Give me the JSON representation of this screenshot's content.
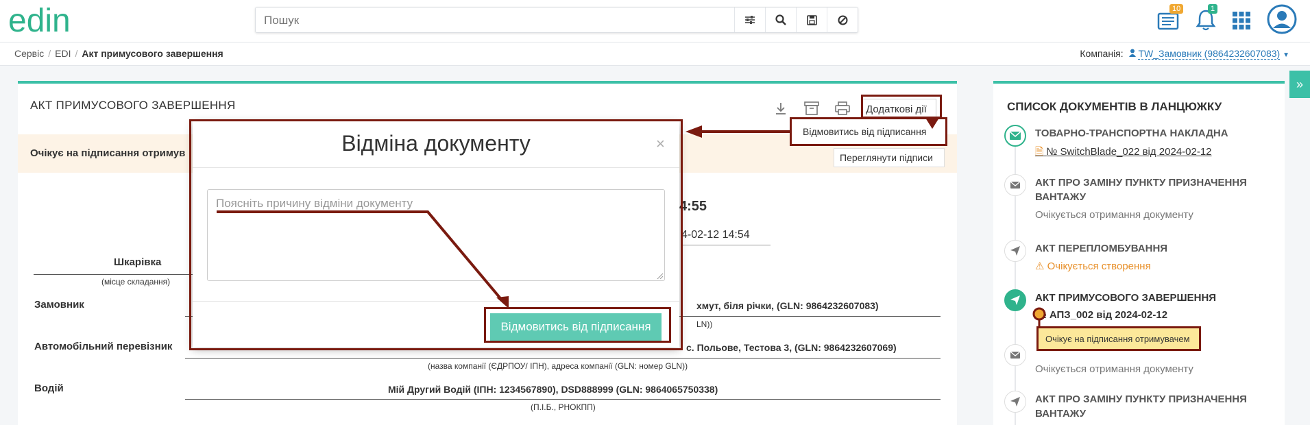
{
  "header": {
    "logo_text": "edin",
    "search_placeholder": "Пошук",
    "news_badge": "10",
    "notif_badge": "1"
  },
  "breadcrumb": {
    "items": [
      "Сервіс",
      "EDI"
    ],
    "current": "Акт примусового завершення",
    "company_label": "Компанія:",
    "company_value": "TW_Замовник (9864232607083)"
  },
  "main": {
    "title": "АКТ ПРИМУСОВОГО ЗАВЕРШЕННЯ",
    "more_actions": "Додаткові дії",
    "notice": "Очікує на підписання отримув",
    "view_signatures": "Переглянути підписи",
    "time1": "4:55",
    "time2": "4-02-12 14:54",
    "place_value": "Шкарівка",
    "place_caption": "(місце складання)",
    "customer_label": "Замовник",
    "customer_value": "хмут, біля річки, (GLN: 9864232607083)",
    "customer_caption": "LN))",
    "carrier_label": "Автомобільний перевізник",
    "carrier_value": "с. Польове, Тестова 3, (GLN: 9864232607069)",
    "carrier_caption": "(назва компанії (ЄДРПОУ/ ІПН), адреса компанії (GLN: номер GLN))",
    "driver_label": "Водій",
    "driver_value": "Мій Другий Водій (ІПН: 1234567890), DSD888999 (GLN: 9864065750338)",
    "driver_caption": "(П.І.Б., РНОКПП)"
  },
  "dropdown": {
    "refuse_sign": "Відмовитись від підписання"
  },
  "side": {
    "title": "СПИСОК ДОКУМЕНТІВ В ЛАНЦЮЖКУ",
    "items": [
      {
        "title": "ТОВАРНО-ТРАНСПОРТНА НАКЛАДНА",
        "sub": "№ SwitchBlade_022 від 2024-02-12"
      },
      {
        "title": "АКТ ПРО ЗАМІНУ ПУНКТУ ПРИЗНАЧЕННЯ ВАНТАЖУ",
        "sub": "Очікується отримання документу"
      },
      {
        "title": "АКТ ПЕРЕПЛОМБУВАННЯ",
        "sub": "Очікується створення"
      },
      {
        "title": "АКТ ПРИМУСОВОГО ЗАВЕРШЕННЯ",
        "sub": "№ АПЗ_002 від 2024-02-12",
        "badge": "Очікує на підписання отримувачем"
      },
      {
        "title": "",
        "sub": "Очікується отримання документу"
      },
      {
        "title": "АКТ ПРО ЗАМІНУ ПУНКТУ ПРИЗНАЧЕННЯ ВАНТАЖУ",
        "sub": ""
      }
    ]
  },
  "modal": {
    "title": "Відміна документу",
    "close": "×",
    "placeholder": "Поясніть причину відміни документу",
    "submit": "Відмовитись від підписання"
  },
  "colors": {
    "accent": "#3cc0a7",
    "annotation": "#7a1a0f",
    "notice_bg": "#fdf3e6",
    "badge_bg": "#fce89a"
  }
}
